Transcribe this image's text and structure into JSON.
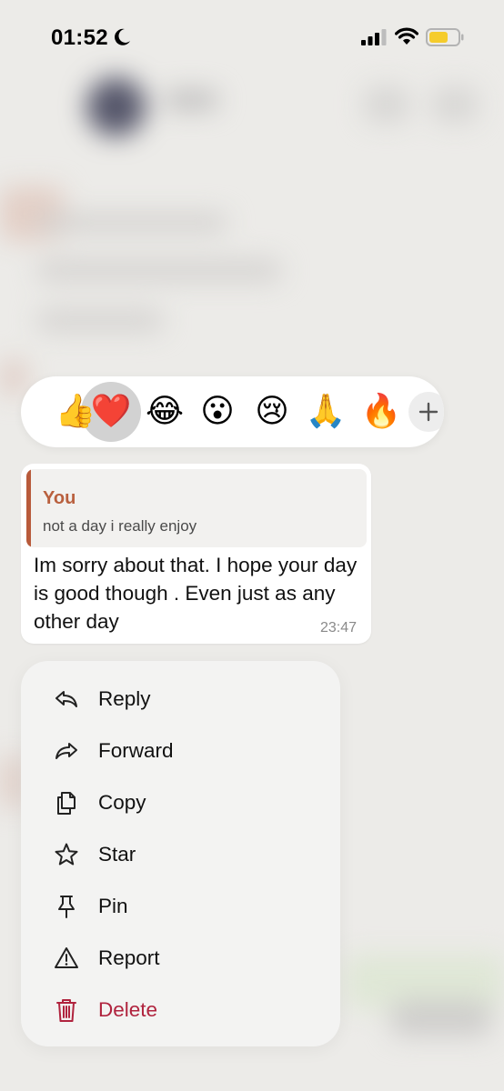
{
  "status_bar": {
    "time": "01:52",
    "icons": [
      "moon-icon",
      "signal-icon",
      "wifi-icon",
      "battery-icon"
    ]
  },
  "reactions": {
    "emojis": [
      "👍",
      "❤️",
      "😂",
      "😮",
      "😢",
      "🙏",
      "🔥"
    ],
    "selected": "❤️",
    "more_icon": "plus-icon"
  },
  "message": {
    "quote_author": "You",
    "quote_text": "not a day i really enjoy",
    "text": "Im sorry about that. I hope your day is good though . Even just as any other day",
    "time": "23:47"
  },
  "menu": {
    "items": [
      {
        "label": "Reply",
        "icon": "reply-icon"
      },
      {
        "label": "Forward",
        "icon": "forward-icon"
      },
      {
        "label": "Copy",
        "icon": "copy-icon"
      },
      {
        "label": "Star",
        "icon": "star-icon"
      },
      {
        "label": "Pin",
        "icon": "pin-icon"
      },
      {
        "label": "Report",
        "icon": "report-icon"
      },
      {
        "label": "Delete",
        "icon": "trash-icon"
      }
    ]
  },
  "colors": {
    "accent": "#b9603e",
    "danger": "#b0233e",
    "background": "#ecebe8"
  }
}
